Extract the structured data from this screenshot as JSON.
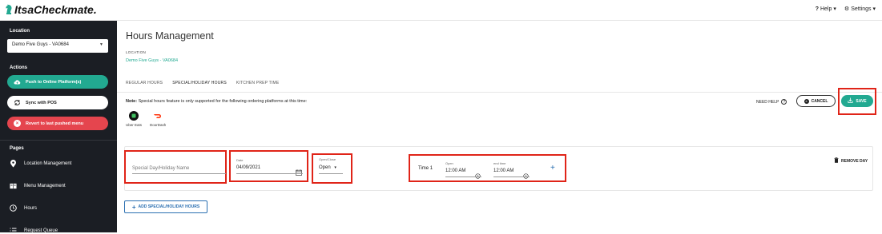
{
  "header": {
    "logo_text": "ItsaCheckmate.",
    "help_label": "Help",
    "settings_label": "Settings"
  },
  "sidebar": {
    "location_heading": "Location",
    "location_value": "Demo Five Guys - VA0684",
    "actions_heading": "Actions",
    "push_label": "Push to Online Platform(s)",
    "sync_label": "Sync with POS",
    "revert_label": "Revert to last pushed menu",
    "pages_heading": "Pages",
    "nav": [
      {
        "label": "Location Management",
        "icon": "pin-gear-icon"
      },
      {
        "label": "Menu Management",
        "icon": "menu-book-icon"
      },
      {
        "label": "Hours",
        "icon": "clock-icon"
      },
      {
        "label": "Request Queue",
        "icon": "list-icon"
      }
    ]
  },
  "main": {
    "title": "Hours Management",
    "location_label": "LOCATION",
    "location_name": "Demo Five Guys - VA0684",
    "tabs": [
      {
        "label": "REGULAR HOURS",
        "active": false
      },
      {
        "label": "SPECIAL/HOLIDAY HOURS",
        "active": true
      },
      {
        "label": "KITCHEN PREP TIME",
        "active": false
      }
    ],
    "note_bold": "Note:",
    "note_text": "Special hours feature is only supported for the following ordering platforms at this time:",
    "platforms": [
      {
        "name": "Uber Eats",
        "color": "#111111"
      },
      {
        "name": "DoorDash",
        "color": "#ff3008"
      }
    ],
    "need_help": "NEED HELP",
    "cancel_label": "CANCEL",
    "save_label": "SAVE",
    "special_day": {
      "name_placeholder": "Special Day/Holiday Name",
      "date_label": "Date",
      "date_value": "04/09/2021",
      "open_close_label": "Open/Close",
      "open_close_value": "Open",
      "time_label": "Time 1",
      "open_label": "Open",
      "open_value": "12:00 AM",
      "end_label": "end time",
      "end_value": "12:00 AM",
      "remove_label": "REMOVE DAY"
    },
    "add_label": "ADD SPECIAL/HOLIDAY HOURS"
  },
  "colors": {
    "accent": "#22a991",
    "sidebar_bg": "#1b1e24",
    "revert": "#e5454e",
    "highlight_box": "#e02418",
    "link_blue": "#2a6fb1"
  }
}
